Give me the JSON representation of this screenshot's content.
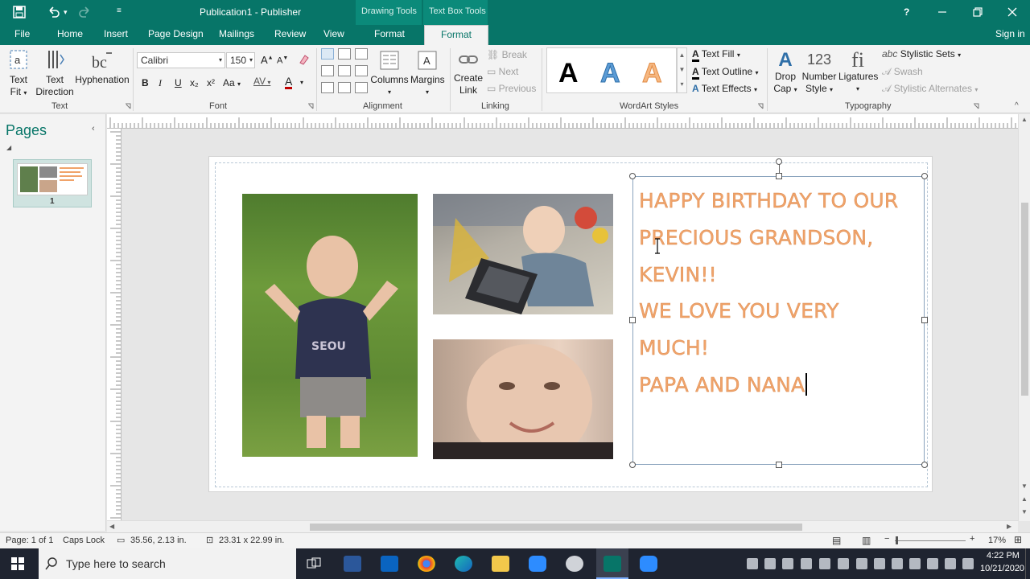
{
  "window": {
    "title": "Publication1 - Publisher",
    "context_tabs": [
      "Drawing Tools",
      "Text Box Tools"
    ],
    "help": "?",
    "controls": [
      "minimize",
      "restore",
      "close"
    ]
  },
  "tabs": [
    "File",
    "Home",
    "Insert",
    "Page Design",
    "Mailings",
    "Review",
    "View",
    "Format",
    "Format"
  ],
  "active_tab_index": 8,
  "sign_in": "Sign in",
  "ribbon": {
    "text_group": {
      "label": "Text",
      "text_fit": [
        "Text",
        "Fit"
      ],
      "text_direction": [
        "Text",
        "Direction"
      ],
      "hyphenation": "Hyphenation"
    },
    "font_group": {
      "label": "Font",
      "font_name": "Calibri",
      "font_size": "150",
      "buttons": [
        "B",
        "I",
        "U",
        "x₂",
        "x²",
        "Aa"
      ]
    },
    "alignment_group": {
      "label": "Alignment",
      "columns": "Columns",
      "margins": "Margins"
    },
    "linking_group": {
      "label": "Linking",
      "create_link": [
        "Create",
        "Link"
      ],
      "break": "Break",
      "next": "Next",
      "previous": "Previous"
    },
    "wordart_group": {
      "label": "WordArt Styles",
      "styles": [
        "A",
        "A",
        "A"
      ],
      "text_fill": "Text Fill",
      "text_outline": "Text Outline",
      "text_effects": "Text Effects"
    },
    "typography_group": {
      "label": "Typography",
      "drop_cap": [
        "Drop",
        "Cap"
      ],
      "number_style": [
        "Number",
        "Style"
      ],
      "ligatures": "Ligatures",
      "stylistic_sets": "Stylistic Sets",
      "swash": "Swash",
      "stylistic_alternates": "Stylistic Alternates"
    }
  },
  "pages_pane": {
    "title": "Pages",
    "page_number": "1"
  },
  "document": {
    "text_lines": [
      "HAPPY BIRTHDAY TO OUR",
      "PRECIOUS GRANDSON,",
      "KEVIN!!",
      "WE LOVE YOU VERY",
      "MUCH!",
      "PAPA AND NANA"
    ],
    "text_color": "#f0a36a"
  },
  "status": {
    "page": "Page: 1 of 1",
    "caps": "Caps Lock",
    "position": "35.56, 2.13 in.",
    "size": "23.31 x 22.99 in.",
    "zoom": "17%"
  },
  "taskbar": {
    "search_placeholder": "Type here to search",
    "time": "4:22 PM",
    "date": "10/21/2020"
  },
  "colors": {
    "accent": "#077568",
    "wordart_orange": "#f0a36a",
    "wordart_blue": "#5b9bd5"
  }
}
